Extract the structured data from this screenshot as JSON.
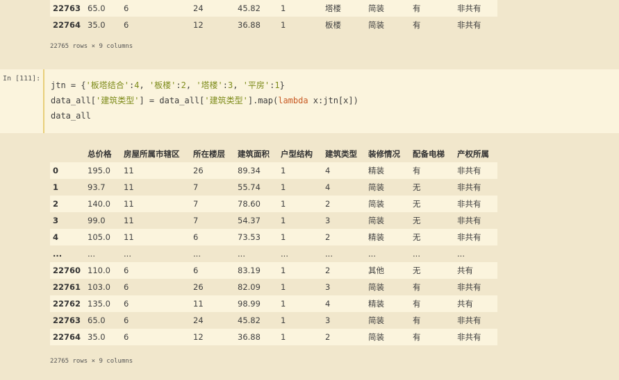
{
  "top_rows": [
    {
      "idx": "22763",
      "c": [
        "65.0",
        "6",
        "24",
        "45.82",
        "1",
        "塔楼",
        "简装",
        "有",
        "非共有"
      ]
    },
    {
      "idx": "22764",
      "c": [
        "35.0",
        "6",
        "12",
        "36.88",
        "1",
        "板楼",
        "简装",
        "有",
        "非共有"
      ]
    }
  ],
  "top_note": "22765 rows × 9 columns",
  "cell": {
    "prompt": "In [111]:",
    "line1": {
      "a": "jtn = {",
      "s1": "'板塔结合'",
      "c1": ":",
      "n1": "4",
      "d1": ", ",
      "s2": "'板楼'",
      "c2": ":",
      "n2": "2",
      "d2": ", ",
      "s3": "'塔楼'",
      "c3": ":",
      "n3": "3",
      "d3": ", ",
      "s4": "'平房'",
      "c4": ":",
      "n4": "1",
      "e": "}"
    },
    "line2": {
      "a": "data_all[",
      "s1": "'建筑类型'",
      "b": "] = data_all[",
      "s2": "'建筑类型'",
      "c": "].map(",
      "kw": "lambda",
      "d": " x:jtn[x])"
    },
    "line3": "data_all"
  },
  "table": {
    "headers": [
      "",
      "总价格",
      "房屋所属市辖区",
      "所在楼层",
      "建筑面积",
      "户型结构",
      "建筑类型",
      "装修情况",
      "配备电梯",
      "产权所属"
    ],
    "rows": [
      {
        "idx": "0",
        "c": [
          "195.0",
          "11",
          "26",
          "89.34",
          "1",
          "4",
          "精装",
          "有",
          "非共有"
        ]
      },
      {
        "idx": "1",
        "c": [
          "93.7",
          "11",
          "7",
          "55.74",
          "1",
          "4",
          "简装",
          "无",
          "非共有"
        ]
      },
      {
        "idx": "2",
        "c": [
          "140.0",
          "11",
          "7",
          "78.60",
          "1",
          "2",
          "简装",
          "无",
          "非共有"
        ]
      },
      {
        "idx": "3",
        "c": [
          "99.0",
          "11",
          "7",
          "54.37",
          "1",
          "3",
          "简装",
          "无",
          "非共有"
        ]
      },
      {
        "idx": "4",
        "c": [
          "105.0",
          "11",
          "6",
          "73.53",
          "1",
          "2",
          "精装",
          "无",
          "非共有"
        ]
      },
      {
        "idx": "...",
        "c": [
          "...",
          "...",
          "...",
          "...",
          "...",
          "...",
          "...",
          "...",
          "..."
        ]
      },
      {
        "idx": "22760",
        "c": [
          "110.0",
          "6",
          "6",
          "83.19",
          "1",
          "2",
          "其他",
          "无",
          "共有"
        ]
      },
      {
        "idx": "22761",
        "c": [
          "103.0",
          "6",
          "26",
          "82.09",
          "1",
          "3",
          "简装",
          "有",
          "非共有"
        ]
      },
      {
        "idx": "22762",
        "c": [
          "135.0",
          "6",
          "11",
          "98.99",
          "1",
          "4",
          "精装",
          "有",
          "共有"
        ]
      },
      {
        "idx": "22763",
        "c": [
          "65.0",
          "6",
          "24",
          "45.82",
          "1",
          "3",
          "简装",
          "有",
          "非共有"
        ]
      },
      {
        "idx": "22764",
        "c": [
          "35.0",
          "6",
          "12",
          "36.88",
          "1",
          "2",
          "简装",
          "有",
          "非共有"
        ]
      }
    ]
  },
  "bottom_note": "22765 rows × 9 columns"
}
